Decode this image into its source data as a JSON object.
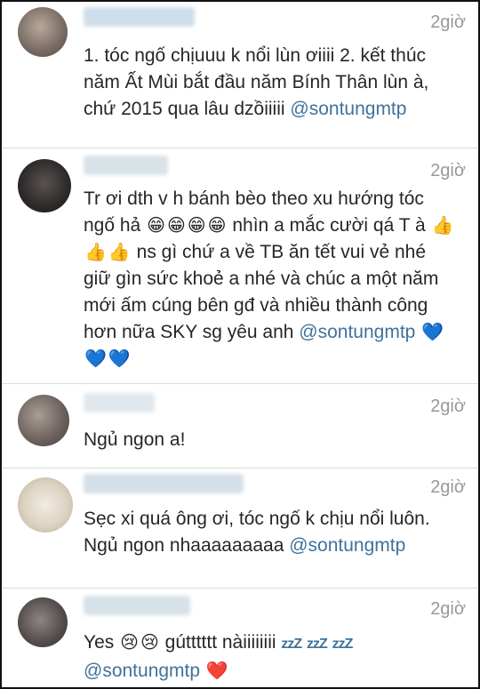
{
  "colors": {
    "mention": "#3f729b",
    "timestamp": "#999999",
    "text": "#262626",
    "divider": "#dbdbdb"
  },
  "comments": [
    {
      "time": "2giờ",
      "text_a": "1. tóc ngố chịuuu k nổi lùn ơiiii  2. kết thúc năm Ất Mùi bắt đầu năm Bính Thân lùn à, chứ 2015 qua lâu dzồiiiii",
      "mention": "@sontungmtp"
    },
    {
      "time": "2giờ",
      "text_a": "Tr ơi dth v h bánh bèo theo xu hướng tóc ngố hả",
      "emoji_grin": "😁",
      "text_b": "nhìn a mắc cười qá T à",
      "emoji_thumb": "👍",
      "text_c": "ns gì chứ a về TB ăn tết vui vẻ nhé giữ gìn sức khoẻ a nhé và chúc a một năm mới ấm cúng bên gđ và nhiều thành công hơn nữa SKY sg yêu anh",
      "mention": "@sontungmtp",
      "emoji_heart": "💙"
    },
    {
      "time": "2giờ",
      "text_a": "Ngủ ngon a!"
    },
    {
      "time": "2giờ",
      "text_a": "Sẹc xi quá ông ơi, tóc ngố k chịu nổi luôn. Ngủ ngon nhaaaaaaaaa",
      "mention": "@sontungmtp"
    },
    {
      "time": "2giờ",
      "text_a": "Yes",
      "emoji_cry": "😢",
      "text_b": "gútttttt nàiiiiiiii",
      "zzz": "zzZ",
      "mention": "@sontungmtp",
      "emoji_heart": "❤️"
    }
  ]
}
